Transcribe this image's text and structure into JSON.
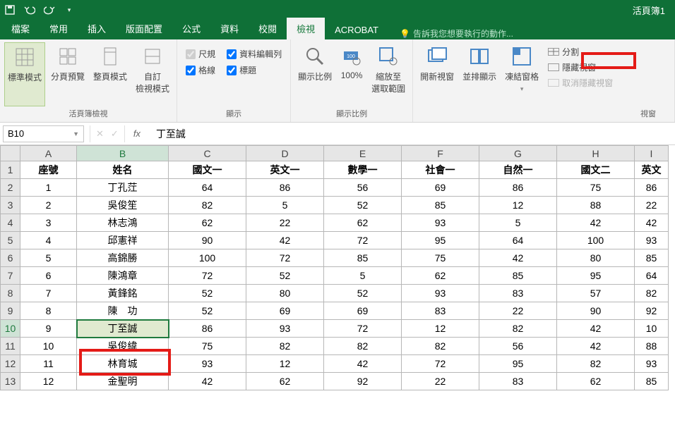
{
  "titlebar": {
    "filename": "活頁簿1"
  },
  "tabs": {
    "file": "檔案",
    "home": "常用",
    "insert": "插入",
    "layout": "版面配置",
    "formulas": "公式",
    "data": "資料",
    "review": "校閱",
    "view": "檢視",
    "acrobat": "ACROBAT",
    "tellme": "告訴我您想要執行的動作..."
  },
  "ribbon": {
    "views": {
      "normal": "標準模式",
      "pagebreak": "分頁預覽",
      "page": "整頁模式",
      "custom": "自訂\n檢視模式",
      "group": "活頁簿檢視"
    },
    "show": {
      "ruler": "尺規",
      "formula": "資料編輯列",
      "grid": "格線",
      "heading": "標題",
      "group": "顯示"
    },
    "zoom": {
      "zoom": "顯示比例",
      "p100": "100%",
      "sel": "縮放至\n選取範圍",
      "group": "顯示比例"
    },
    "window": {
      "new": "開新視窗",
      "arrange": "並排顯示",
      "freeze": "凍結窗格",
      "split": "分割",
      "hide": "隱藏視窗",
      "unhide": "取消隱藏視窗",
      "group": "視窗"
    }
  },
  "formula": {
    "cell": "B10",
    "value": "丁至誠"
  },
  "cols": [
    "A",
    "B",
    "C",
    "D",
    "E",
    "F",
    "G",
    "H",
    "I"
  ],
  "headers": [
    "座號",
    "姓名",
    "國文一",
    "英文一",
    "數學一",
    "社會一",
    "自然一",
    "國文二",
    "英文"
  ],
  "rows": [
    {
      "r": "1",
      "a": "1",
      "b": "丁孔茳",
      "c": "64",
      "d": "86",
      "e": "56",
      "f": "69",
      "g": "86",
      "h": "75",
      "i": "86"
    },
    {
      "r": "2",
      "a": "2",
      "b": "吳俊笙",
      "c": "82",
      "d": "5",
      "e": "52",
      "f": "85",
      "g": "12",
      "h": "88",
      "i": "22"
    },
    {
      "r": "3",
      "a": "3",
      "b": "林志鴻",
      "c": "62",
      "d": "22",
      "e": "62",
      "f": "93",
      "g": "5",
      "h": "42",
      "i": "42"
    },
    {
      "r": "4",
      "a": "4",
      "b": "邱憲祥",
      "c": "90",
      "d": "42",
      "e": "72",
      "f": "95",
      "g": "64",
      "h": "100",
      "i": "93"
    },
    {
      "r": "5",
      "a": "5",
      "b": "高錦勝",
      "c": "100",
      "d": "72",
      "e": "85",
      "f": "75",
      "g": "42",
      "h": "80",
      "i": "85"
    },
    {
      "r": "6",
      "a": "6",
      "b": "陳鴻章",
      "c": "72",
      "d": "52",
      "e": "5",
      "f": "62",
      "g": "85",
      "h": "95",
      "i": "64"
    },
    {
      "r": "7",
      "a": "7",
      "b": "黃鋒銘",
      "c": "52",
      "d": "80",
      "e": "52",
      "f": "93",
      "g": "83",
      "h": "57",
      "i": "82"
    },
    {
      "r": "8",
      "a": "8",
      "b": "陳　功",
      "c": "52",
      "d": "69",
      "e": "69",
      "f": "83",
      "g": "22",
      "h": "90",
      "i": "92"
    },
    {
      "r": "9",
      "a": "9",
      "b": "丁至誠",
      "c": "86",
      "d": "93",
      "e": "72",
      "f": "12",
      "g": "82",
      "h": "42",
      "i": "10"
    },
    {
      "r": "10",
      "a": "10",
      "b": "吳俊緯",
      "c": "75",
      "d": "82",
      "e": "82",
      "f": "82",
      "g": "56",
      "h": "42",
      "i": "88"
    },
    {
      "r": "11",
      "a": "11",
      "b": "林育城",
      "c": "93",
      "d": "12",
      "e": "42",
      "f": "72",
      "g": "95",
      "h": "82",
      "i": "93"
    },
    {
      "r": "12",
      "a": "12",
      "b": "金聖明",
      "c": "42",
      "d": "62",
      "e": "92",
      "f": "22",
      "g": "83",
      "h": "62",
      "i": "85"
    }
  ],
  "chart_data": {
    "type": "table",
    "note": "spreadsheet data as rendered",
    "columns": [
      "座號",
      "姓名",
      "國文一",
      "英文一",
      "數學一",
      "社會一",
      "自然一",
      "國文二",
      "英文"
    ],
    "rows_ref": "rows"
  }
}
